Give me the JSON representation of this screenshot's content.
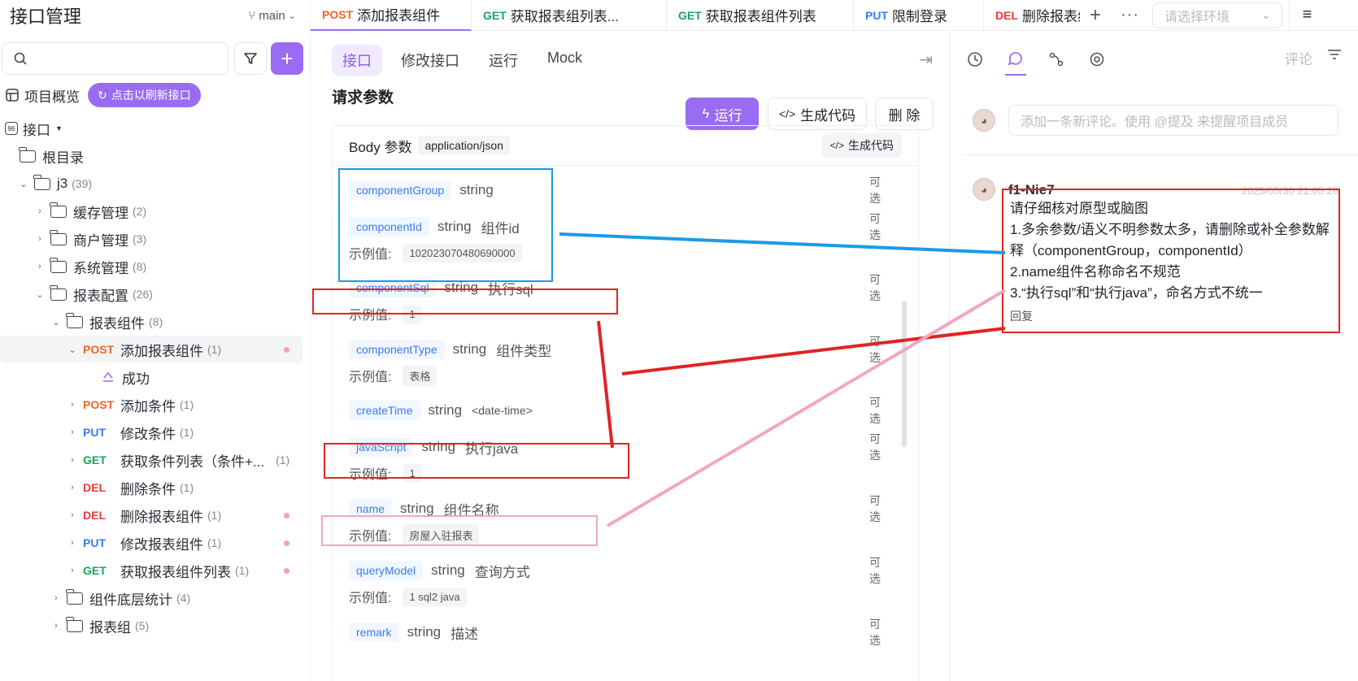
{
  "sidebar": {
    "title": "接口管理",
    "branch": "main",
    "search_placeholder": "",
    "overview": "项目概览",
    "refresh_label": "点击以刷新接口",
    "interfaces_label": "接口",
    "root_label": "根目录",
    "tree": [
      {
        "label": "j3",
        "count": "(39)"
      },
      {
        "label": "缓存管理",
        "count": "(2)"
      },
      {
        "label": "商户管理",
        "count": "(3)"
      },
      {
        "label": "系统管理",
        "count": "(8)"
      },
      {
        "label": "报表配置",
        "count": "(26)"
      },
      {
        "label": "报表组件",
        "count": "(8)"
      },
      {
        "method": "POST",
        "label": "添加报表组件",
        "count": "(1)"
      },
      {
        "label": "成功"
      },
      {
        "method": "POST",
        "label": "添加条件",
        "count": "(1)"
      },
      {
        "method": "PUT",
        "label": "修改条件",
        "count": "(1)"
      },
      {
        "method": "GET",
        "label": "获取条件列表（条件+...",
        "count": "(1)"
      },
      {
        "method": "DEL",
        "label": "删除条件",
        "count": "(1)"
      },
      {
        "method": "DEL",
        "label": "删除报表组件",
        "count": "(1)"
      },
      {
        "method": "PUT",
        "label": "修改报表组件",
        "count": "(1)"
      },
      {
        "method": "GET",
        "label": "获取报表组件列表",
        "count": "(1)"
      },
      {
        "label": "组件底层统计",
        "count": "(4)"
      },
      {
        "label": "报表组",
        "count": "(5)"
      }
    ]
  },
  "tabs": [
    {
      "method": "POST",
      "label": "添加报表组件"
    },
    {
      "method": "GET",
      "label": "获取报表组列表..."
    },
    {
      "method": "GET",
      "label": "获取报表组件列表"
    },
    {
      "method": "PUT",
      "label": "限制登录"
    },
    {
      "method": "DEL",
      "label": "删除报表组"
    }
  ],
  "env_placeholder": "请选择环境",
  "main": {
    "subtabs": [
      "接口",
      "修改接口",
      "运行",
      "Mock"
    ],
    "section_title": "请求参数",
    "run_label": "运行",
    "gen_code_label": "生成代码",
    "delete_label": "删 除",
    "body_label": "Body 参数",
    "content_type": "application/json",
    "gen_small_label": "生成代码",
    "example_label": "示例值:",
    "optional_label": "可选",
    "params": [
      {
        "name": "componentGroup",
        "type": "string",
        "desc": ""
      },
      {
        "name": "componentId",
        "type": "string",
        "desc": "组件id",
        "example": "102023070480690000"
      },
      {
        "name": "componentSql",
        "type": "string",
        "desc": "执行sql",
        "example": "1"
      },
      {
        "name": "componentType",
        "type": "string",
        "desc": "组件类型",
        "example": "表格"
      },
      {
        "name": "createTime",
        "type": "string",
        "desc": "<date-time>"
      },
      {
        "name": "javaScript",
        "type": "string",
        "desc": "执行java",
        "example": "1"
      },
      {
        "name": "name",
        "type": "string",
        "desc": "组件名称",
        "example": "房屋入驻报表"
      },
      {
        "name": "queryModel",
        "type": "string",
        "desc": "查询方式",
        "example": "1 sql2 java"
      },
      {
        "name": "remark",
        "type": "string",
        "desc": "描述"
      }
    ]
  },
  "right": {
    "comment_label": "评论",
    "comment_placeholder": "添加一条新评论。使用 @提及 来提醒项目成员",
    "comment": {
      "author": "f1-Nie7",
      "time": "2025/05/30 21:05:28",
      "lines": [
        "请仔细核对原型或脑图",
        "1.多余参数/语义不明参数太多，请删除或补全参数解释（componentGroup，componentId）",
        "2.name组件名称命名不规范",
        "3.“执行sql”和“执行java”，命名方式不统一"
      ],
      "reply": "回复"
    }
  },
  "colors": {
    "accent": "#9a6cf3",
    "post": "#f06423",
    "get": "#1aa260",
    "put": "#3a7df2",
    "del": "#ec3a3a",
    "annotation_blue": "#1a9be8",
    "annotation_red": "#e02424",
    "annotation_pink": "#f3a6c4"
  }
}
